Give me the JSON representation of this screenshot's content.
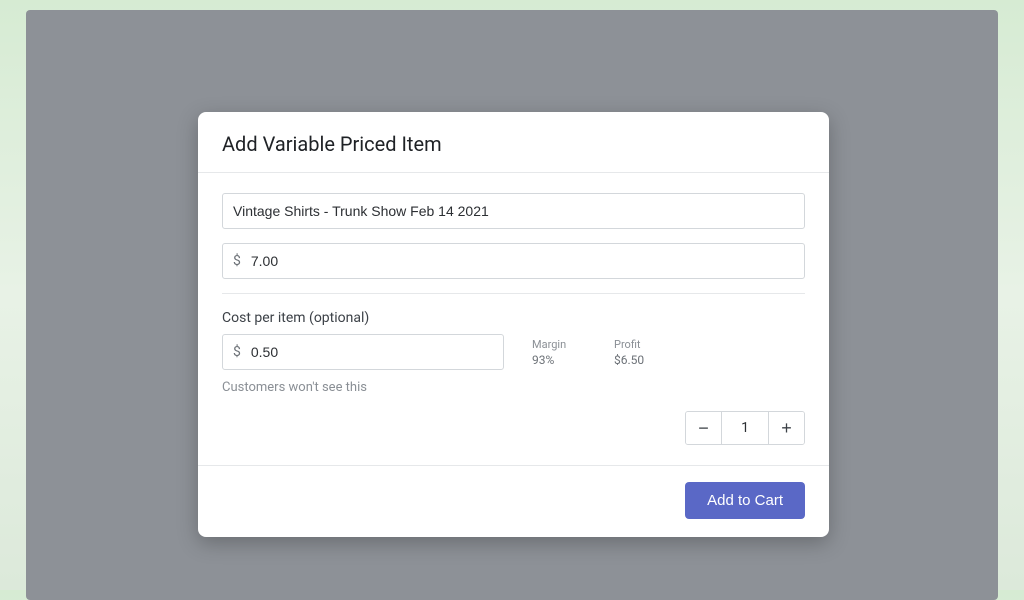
{
  "modal": {
    "title": "Add Variable Priced Item",
    "item_name": "Vintage Shirts - Trunk Show Feb 14 2021",
    "currency_symbol": "$",
    "price": "7.00",
    "cost_section_label": "Cost per item (optional)",
    "cost": "0.50",
    "margin_label": "Margin",
    "margin_value": "93%",
    "profit_label": "Profit",
    "profit_value": "$6.50",
    "cost_hint": "Customers won't see this",
    "quantity": "1",
    "submit_label": "Add to Cart"
  }
}
